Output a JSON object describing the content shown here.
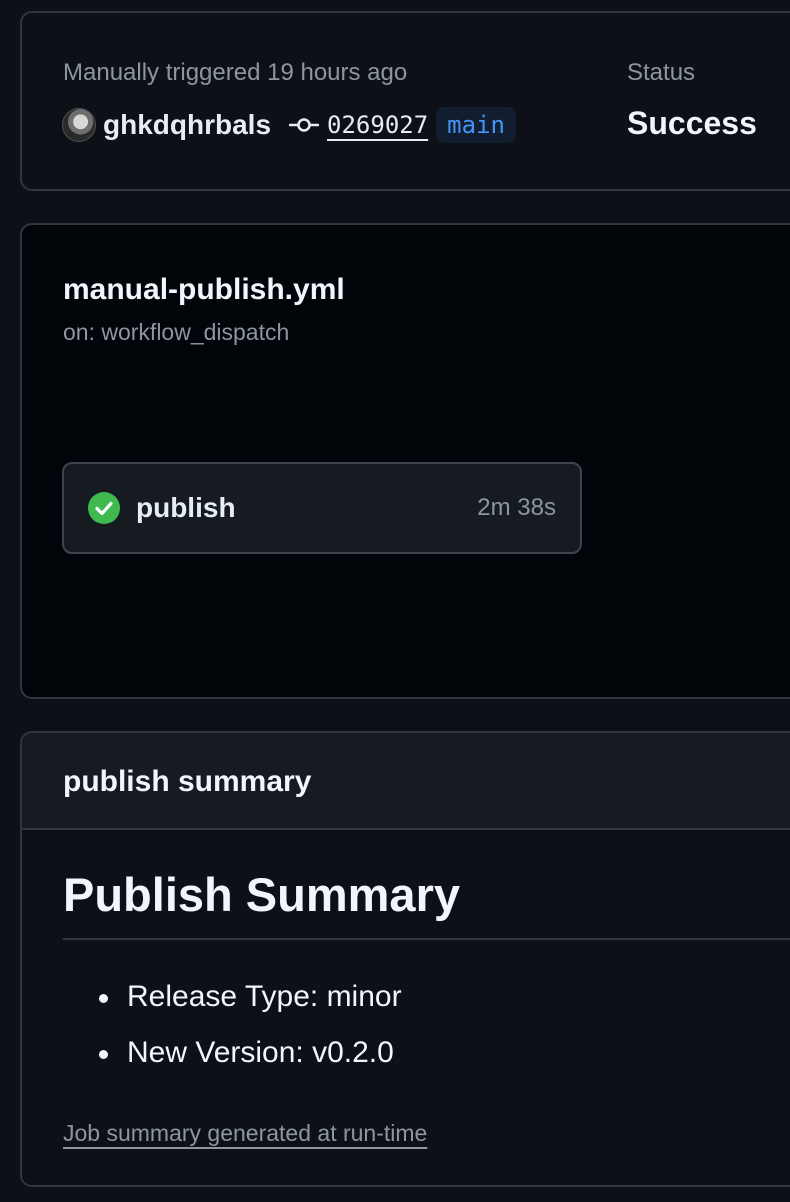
{
  "run": {
    "trigger_text": "Manually triggered 19 hours ago",
    "actor": "ghkdqhrbals",
    "commit_sha": "0269027",
    "branch": "main",
    "status_label": "Status",
    "status_value": "Success"
  },
  "workflow": {
    "file_name": "manual-publish.yml",
    "trigger": "on: workflow_dispatch",
    "jobs": [
      {
        "name": "publish",
        "duration": "2m 38s",
        "status": "success",
        "icon": "check-circle-icon"
      }
    ]
  },
  "summary": {
    "header_title": "publish summary",
    "heading": "Publish Summary",
    "items": [
      "Release Type: minor",
      "New Version: v0.2.0"
    ],
    "footer_link": "Job summary generated at run-time"
  },
  "colors": {
    "background": "#0d1117",
    "success": "#3fb950",
    "accent": "#4493f8",
    "muted_text": "#8d96a0"
  }
}
